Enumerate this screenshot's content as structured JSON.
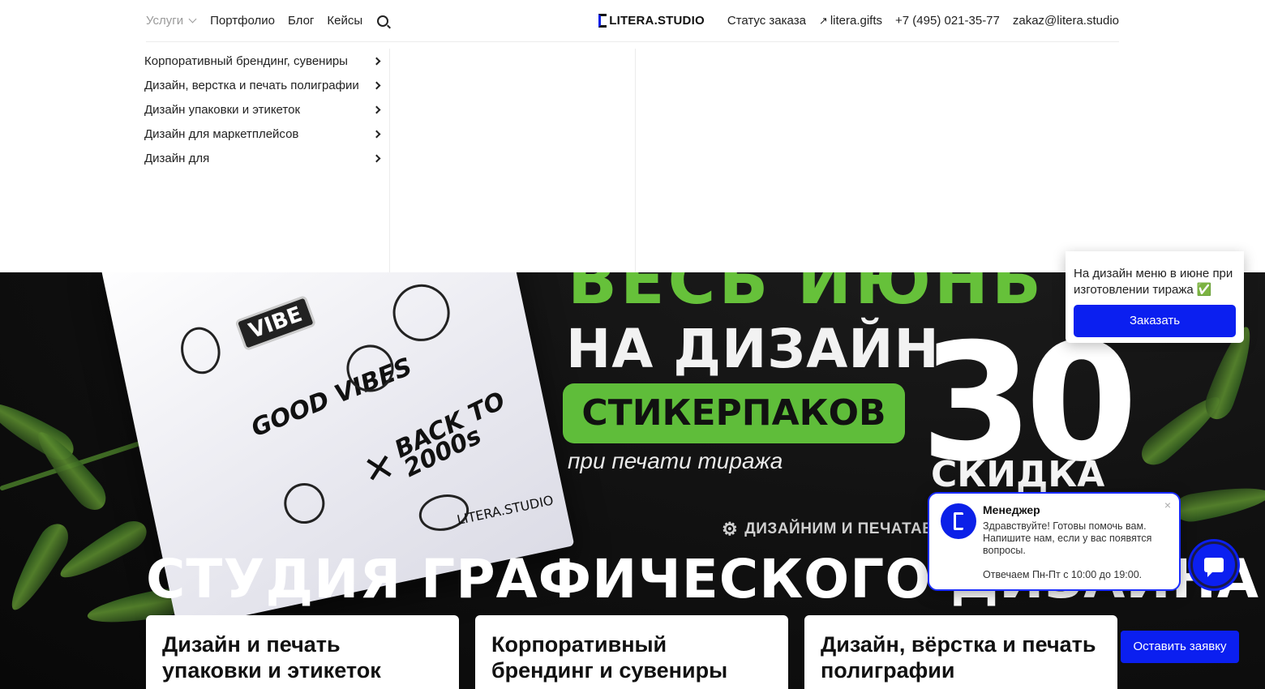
{
  "nav": {
    "services_label": "Услуги",
    "portfolio_label": "Портфолио",
    "blog_label": "Блог",
    "cases_label": "Кейсы",
    "logo_text": "LITERA.STUDIO",
    "order_status_label": "Статус заказа",
    "gifts_label": "litera.gifts",
    "phone": "+7 (495) 021-35-77",
    "email": "zakaz@litera.studio"
  },
  "services_menu": {
    "items": [
      {
        "label": "Корпоративный брендинг, сувениры"
      },
      {
        "label": "Дизайн, верстка и печать полиграфии"
      },
      {
        "label": "Дизайн упаковки и этикеток"
      },
      {
        "label": "Дизайн для маркетплейсов"
      },
      {
        "label": "Дизайн для"
      }
    ]
  },
  "hero": {
    "banner": {
      "top_text": "ВЕСЬ ИЮНЬ",
      "line1": "НА ДИЗАЙН",
      "badge": "СТИКЕРПАКОВ",
      "sub": "при печати тиража",
      "discount_value": "30",
      "discount_unit": "%",
      "discount_label": "СКИДКА",
      "stickers": {
        "vibe": "VIBE",
        "good_vibes": "GOOD VIBES",
        "back_to": "BACK TO 2000s",
        "brand": "LITERA.STUDIO"
      }
    },
    "tagline": "ДИЗАЙНИМ И ПЕЧАТАЕМ Н",
    "title": "СТУДИЯ ГРАФИЧЕСКОГО ДИЗАЙНА",
    "cards": [
      {
        "title": "Дизайн и печать упаковки и этикеток"
      },
      {
        "title": "Корпоративный брендинг и сувениры"
      },
      {
        "title": "Дизайн, вёрстка и печать полиграфии"
      }
    ]
  },
  "promo_popup": {
    "text": "На дизайн меню в июне при изготовлении тиража ✅",
    "button_label": "Заказать"
  },
  "chat": {
    "name": "Менеджер",
    "message": "Здравствуйте! Готовы помочь вам. Напишите нам, если у вас появятся вопросы.",
    "hours": "Отвечаем Пн-Пт с 10:00 до 19:00.",
    "close_glyph": "×"
  },
  "request_button_label": "Оставить заявку",
  "colors": {
    "accent_blue": "#0b1ff0",
    "promo_green": "#5fbd3a"
  }
}
